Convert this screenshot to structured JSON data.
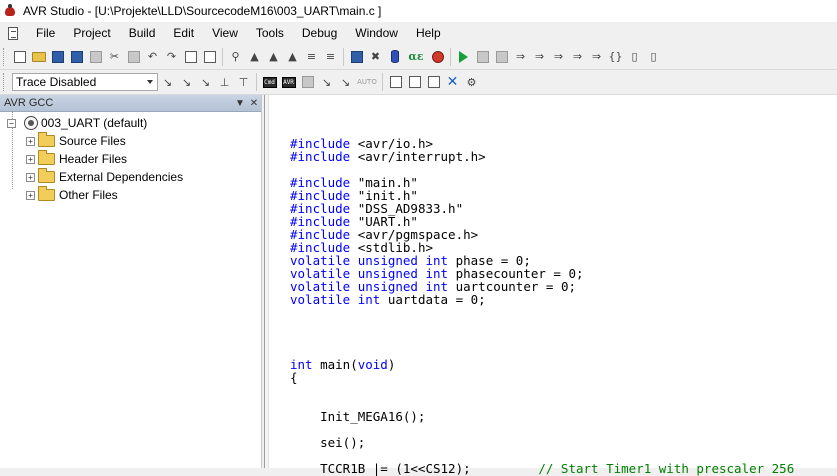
{
  "window": {
    "title": "AVR Studio - [U:\\Projekte\\LLD\\SourcecodeM16\\003_UART\\main.c ]"
  },
  "menu": {
    "items": [
      "File",
      "Project",
      "Build",
      "Edit",
      "View",
      "Tools",
      "Debug",
      "Window",
      "Help"
    ]
  },
  "toolbar2": {
    "trace_value": "Trace Disabled",
    "cmd_label": "Cmd",
    "avr_label": "AVR",
    "auto_label": "AUTO"
  },
  "project_panel": {
    "header": "AVR GCC",
    "root": "003_UART (default)",
    "folders": [
      "Source Files",
      "Header Files",
      "External Dependencies",
      "Other Files"
    ]
  },
  "editor": {
    "code_lines": [
      "",
      "#include <avr/io.h>",
      "#include <avr/interrupt.h>",
      "",
      "#include \"main.h\"",
      "#include \"init.h\"",
      "#include \"DSS_AD9833.h\"",
      "#include \"UART.h\"",
      "#include <avr/pgmspace.h>",
      "#include <stdlib.h>",
      "volatile unsigned int phase = 0;",
      "volatile unsigned int phasecounter = 0;",
      "volatile unsigned int uartcounter = 0;",
      "volatile int uartdata = 0;",
      "",
      "",
      "",
      "",
      "int main(void)",
      "{",
      "",
      "",
      "    Init_MEGA16();",
      "",
      "    sei();",
      "",
      "    TCCR1B |= (1<<CS12);         // Start Timer1 with prescaler 256"
    ]
  },
  "colors": {
    "keyword": "#0000ff",
    "comment": "#008000",
    "panel_header": "#c9d4e3"
  }
}
